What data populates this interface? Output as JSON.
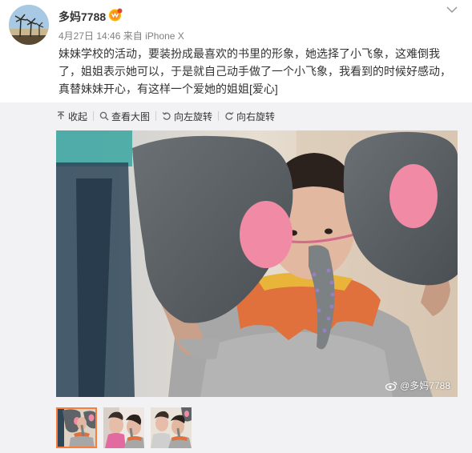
{
  "post": {
    "author": "多妈7788",
    "date": "4月27日 14:46",
    "source_prefix": "来自",
    "source": "iPhone X",
    "text_lines": [
      "妹妹学校的活动，要装扮成最喜欢的书里的形象，她选择了小飞象，这难倒我",
      "了，姐姐表示她可以，于是就自己动手做了一个小飞象，我看到的时候好感动，",
      "真替妹妹开心，有这样一个爱她的姐姐"
    ],
    "emoji_tag": "[爱心]"
  },
  "toolbar": {
    "collapse": "收起",
    "view_large": "查看大图",
    "rotate_left": "向左旋转",
    "rotate_right": "向右旋转"
  },
  "media": {
    "watermark": "@多妈7788",
    "thumbnail_count": 3,
    "active_thumbnail": 1
  },
  "colors": {
    "accent": "#fa7d3c",
    "text": "#333333",
    "meta": "#808080",
    "media_bg": "#f2f2f5"
  },
  "icons": [
    "avatar",
    "vip-badge-icon",
    "chevron-down-icon",
    "collapse-icon",
    "zoom-icon",
    "rotate-left-icon",
    "rotate-right-icon",
    "weibo-icon"
  ]
}
